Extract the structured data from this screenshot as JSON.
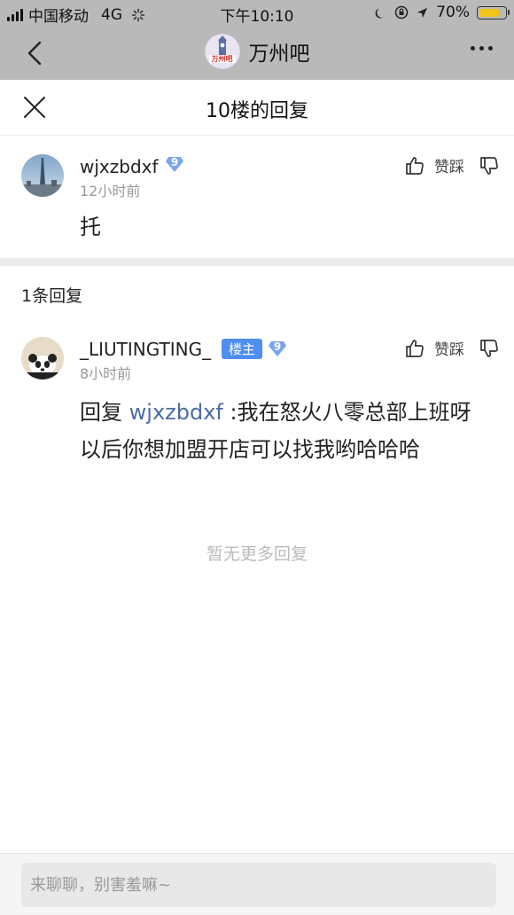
{
  "status_bar": {
    "carrier": "中国移动",
    "network": "4G",
    "time": "下午10:10",
    "battery": "70%",
    "battery_level": 0.7
  },
  "nav": {
    "forum_name": "万州吧",
    "logo_text": "万州吧"
  },
  "sheet": {
    "title": "10楼的回复"
  },
  "main_post": {
    "username": "wjxzbdxf",
    "level": "9",
    "time": "12小时前",
    "content": "托",
    "like_label": "赞踩"
  },
  "reply_count": "1条回复",
  "replies": [
    {
      "username": "_LIUTINGTING_",
      "host_badge": "楼主",
      "level": "9",
      "time": "8小时前",
      "content_prefix": "回复 ",
      "mention": "wjxzbdxf",
      "content_body": " :我在怒火八零总部上班呀 以后你想加盟开店可以找我哟哈哈哈",
      "like_label": "赞踩"
    }
  ],
  "no_more": "暂无更多回复",
  "input": {
    "placeholder": "来聊聊，别害羞嘛~"
  },
  "colors": {
    "header_gray": "#b9b9b9",
    "accent_blue": "#4e8ef0",
    "mention_blue": "#4a6ba5",
    "battery_yellow": "#f0c419"
  }
}
